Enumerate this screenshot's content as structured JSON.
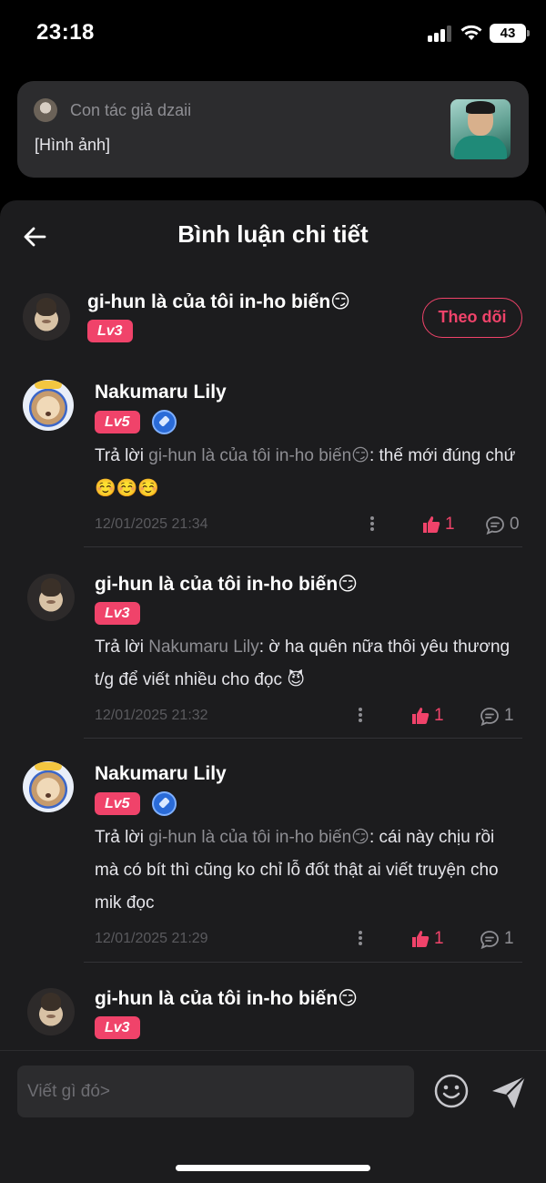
{
  "status_bar": {
    "time": "23:18",
    "battery": "43"
  },
  "notification": {
    "author": "Con tác giả dzaii",
    "text": "[Hình ảnh]"
  },
  "header": {
    "title": "Bình luận chi tiết"
  },
  "main_comment": {
    "user": "gi-hun là của tôi in-ho biến😏",
    "level": "Lv3",
    "follow_label": "Theo dõi"
  },
  "replies": [
    {
      "user": "Nakumaru Lily",
      "level": "Lv5",
      "reply_prefix": "Trả lời ",
      "mention": "gi-hun là của tôi in-ho biến😏",
      "text": ": thế mới đúng chứ ☺️☺️☺️",
      "time": "12/01/2025 21:34",
      "likes": "1",
      "comments": "0"
    },
    {
      "user": "gi-hun là của tôi in-ho biến😏",
      "level": "Lv3",
      "reply_prefix": "Trả lời ",
      "mention": "Nakumaru Lily",
      "text": ": ờ ha quên nữa thôi yêu thương t/g để viết nhiều cho đọc 😈",
      "time": "12/01/2025 21:32",
      "likes": "1",
      "comments": "1"
    },
    {
      "user": "Nakumaru Lily",
      "level": "Lv5",
      "reply_prefix": "Trả lời ",
      "mention": "gi-hun là của tôi in-ho biến😏",
      "text": ": cái này chịu rồi mà có bít thì cũng ko chỉ lỗ đốt thật ai viết truyện cho mik đọc",
      "time": "12/01/2025 21:29",
      "likes": "1",
      "comments": "1"
    },
    {
      "user": "gi-hun là của tôi in-ho biến😏",
      "level": "Lv3"
    }
  ],
  "input": {
    "placeholder": "Viết gì đó>"
  },
  "colors": {
    "accent": "#f0436a",
    "background": "#1c1c1e",
    "crystal": "#2a6bd8"
  },
  "icons": {
    "back": "arrow-left-icon",
    "like": "thumbs-up-icon",
    "comment": "speech-bubble-icon",
    "more": "vertical-dots-icon",
    "emoji": "smiley-icon",
    "send": "paper-plane-icon",
    "badge": "crystal-badge-icon"
  }
}
